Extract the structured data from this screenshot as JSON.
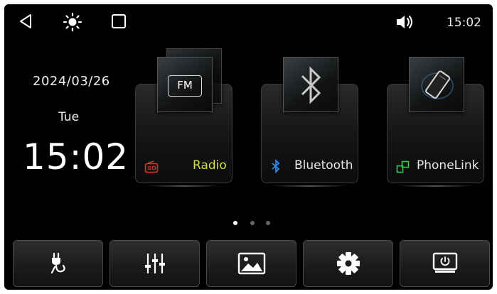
{
  "status_bar": {
    "time": "15:02",
    "icons": [
      "back-triangle-icon",
      "brightness-icon",
      "recent-apps-square-icon",
      "volume-icon"
    ]
  },
  "datetime": {
    "date": "2024/03/26",
    "weekday": "Tue",
    "time": "15:02"
  },
  "apps": [
    {
      "label": "Radio",
      "tile_text": "FM",
      "label_color": "#d4e03a",
      "small_icon": "radio-icon",
      "small_icon_color": "#e03030"
    },
    {
      "label": "Bluetooth",
      "small_icon": "bluetooth-icon",
      "small_icon_color": "#2f8fe8"
    },
    {
      "label": "PhoneLink",
      "small_icon": "phonelink-icon",
      "small_icon_color": "#2ec84a"
    }
  ],
  "pager": {
    "pages": 3,
    "active": 0
  },
  "dock": [
    "cables-icon",
    "equalizer-icon",
    "gallery-icon",
    "settings-gear-icon",
    "screen-power-icon"
  ]
}
